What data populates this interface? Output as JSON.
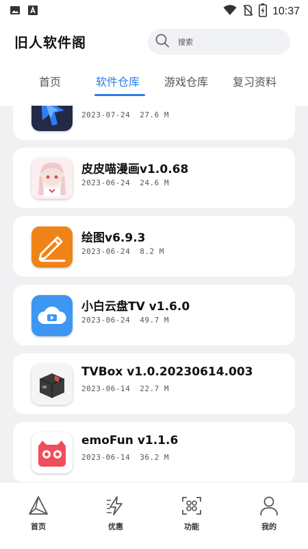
{
  "status_bar": {
    "time": "10:37",
    "left_icons": [
      "image-icon",
      "a-icon"
    ],
    "right_icons": [
      "wifi-icon",
      "no-sim-icon",
      "battery-icon"
    ]
  },
  "header": {
    "title": "旧人软件阁",
    "search": {
      "placeholder": "搜索",
      "value": ""
    }
  },
  "tabs": [
    {
      "label": "首页",
      "active": false
    },
    {
      "label": "软件仓库",
      "active": true
    },
    {
      "label": "游戏仓库",
      "active": false
    },
    {
      "label": "复习资料",
      "active": false
    }
  ],
  "apps": [
    {
      "name": "",
      "date": "2023-07-24",
      "size": "27.6 M",
      "icon": "blue-cursor-icon"
    },
    {
      "name": "皮皮喵漫画v1.0.68",
      "date": "2023-06-24",
      "size": "24.6 M",
      "icon": "anime-girl-icon"
    },
    {
      "name": "绘图v6.9.3",
      "date": "2023-06-24",
      "size": "8.2 M",
      "icon": "pencil-icon"
    },
    {
      "name": "小白云盘TV  v1.6.0",
      "date": "2023-06-24",
      "size": "49.7 M",
      "icon": "cloud-play-icon"
    },
    {
      "name": "TVBox  v1.0.20230614.003",
      "date": "2023-06-14",
      "size": "22.7 M",
      "icon": "box-icon"
    },
    {
      "name": "emoFun  v1.1.6",
      "date": "2023-06-14",
      "size": "36.2 M",
      "icon": "emo-face-icon"
    }
  ],
  "bottom_nav": [
    {
      "label": "首页",
      "icon": "triangle-home-icon"
    },
    {
      "label": "优惠",
      "icon": "lightning-icon"
    },
    {
      "label": "功能",
      "icon": "scan-icon"
    },
    {
      "label": "我的",
      "icon": "person-icon"
    }
  ],
  "colors": {
    "accent": "#2a7be8",
    "list_background": "#f1f1f3",
    "card_background": "#ffffff"
  }
}
